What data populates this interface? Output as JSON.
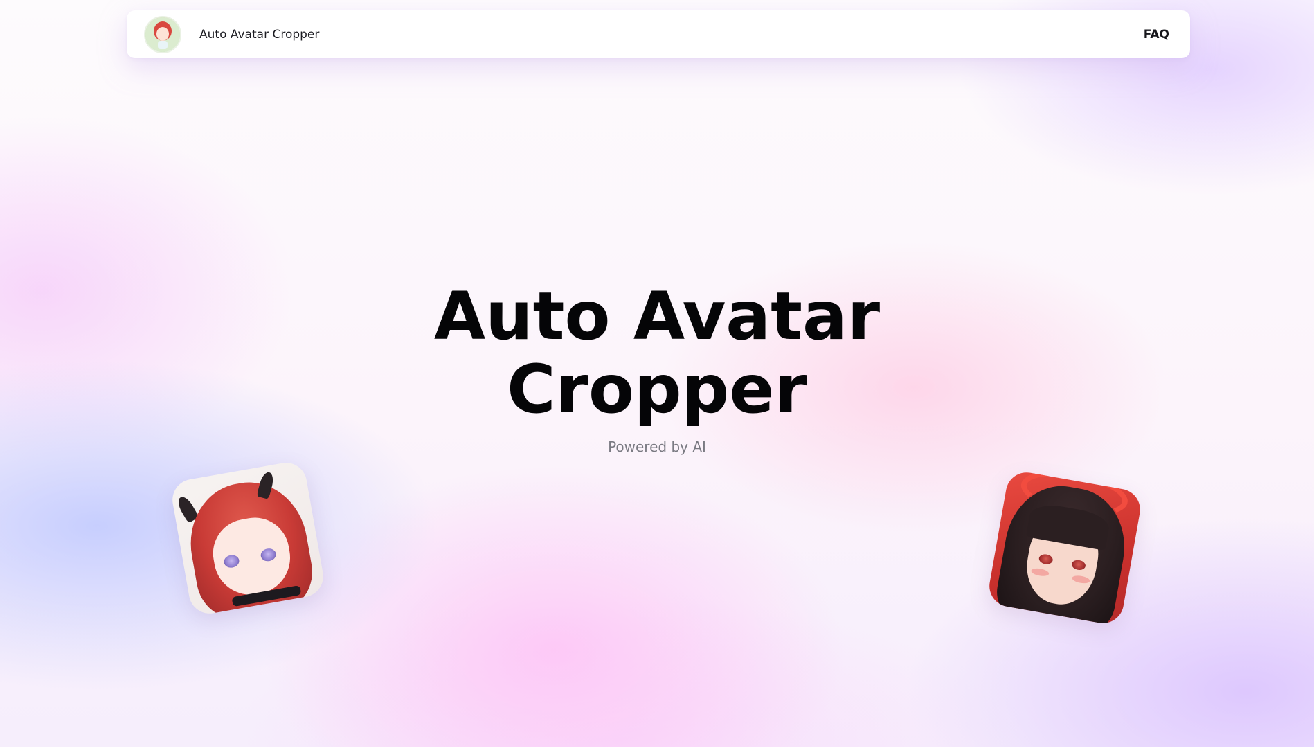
{
  "navbar": {
    "logo_icon": "anime-avatar-logo-icon",
    "brand": "Auto Avatar Cropper",
    "faq_label": "FAQ"
  },
  "hero": {
    "title_line1": "Auto Avatar",
    "title_line2": "Cropper",
    "subtitle": "Powered by AI"
  },
  "decorations": {
    "left_card_icon": "red-hair-anime-avatar-image",
    "right_card_icon": "dark-hair-anime-avatar-image"
  },
  "colors": {
    "title": "#050507",
    "subtitle": "#7a7a82",
    "navbar_bg": "#ffffff"
  }
}
